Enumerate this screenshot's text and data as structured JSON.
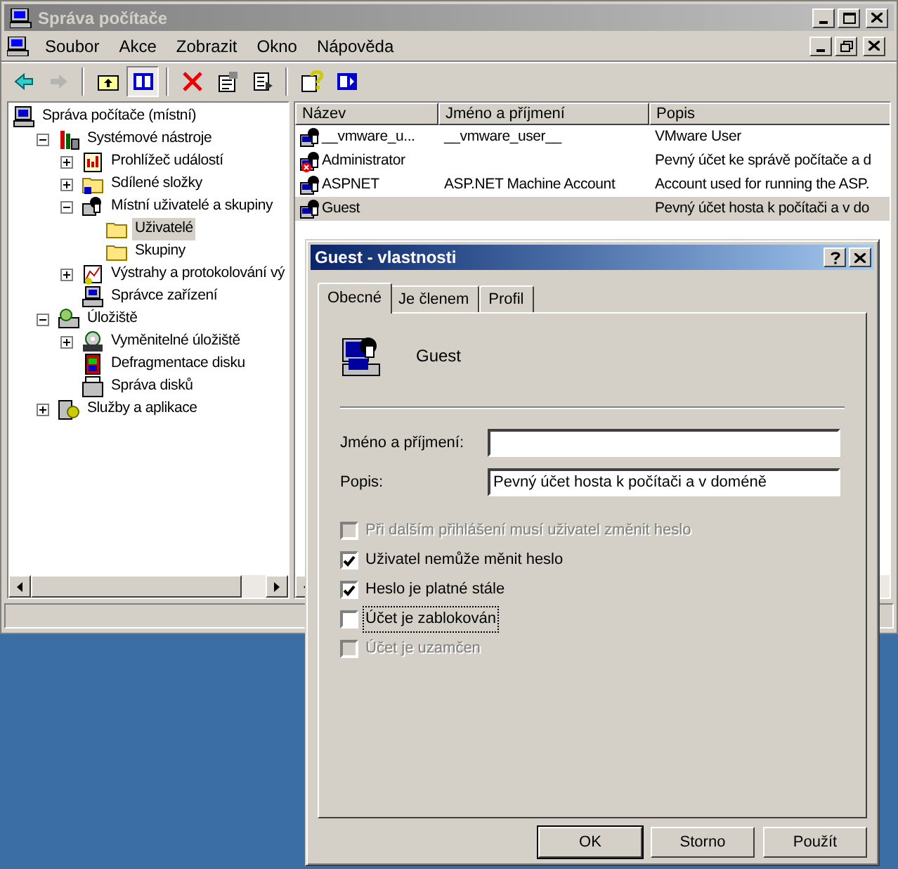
{
  "window": {
    "title": "Správa počítače"
  },
  "menu": [
    "Soubor",
    "Akce",
    "Zobrazit",
    "Okno",
    "Nápověda"
  ],
  "toolbar": [
    {
      "kind": "back",
      "disabled": false,
      "pressed": false
    },
    {
      "kind": "forward",
      "disabled": true,
      "pressed": false
    },
    {
      "kind": "separator"
    },
    {
      "kind": "up",
      "disabled": false,
      "pressed": false
    },
    {
      "kind": "tree",
      "disabled": false,
      "pressed": true
    },
    {
      "kind": "separator"
    },
    {
      "kind": "delete",
      "disabled": false,
      "pressed": false
    },
    {
      "kind": "properties",
      "disabled": false,
      "pressed": false
    },
    {
      "kind": "export",
      "disabled": false,
      "pressed": false
    },
    {
      "kind": "separator"
    },
    {
      "kind": "help",
      "disabled": false,
      "pressed": false
    },
    {
      "kind": "panel",
      "disabled": false,
      "pressed": false
    }
  ],
  "tree": [
    {
      "label": "Správa počítače (místní)",
      "selected": false,
      "children": [
        {
          "label": "Systémové nástroje",
          "selected": false,
          "expanded": true,
          "children": [
            {
              "label": "Prohlížeč událostí",
              "selected": false,
              "expanded": false
            },
            {
              "label": "Sdílené složky",
              "selected": false,
              "expanded": false
            },
            {
              "label": "Místní uživatelé a skupiny",
              "selected": false,
              "expanded": true,
              "children": [
                {
                  "label": "Uživatelé",
                  "selected": true
                },
                {
                  "label": "Skupiny",
                  "selected": false
                }
              ]
            },
            {
              "label": "Výstrahy a protokolování vý",
              "selected": false,
              "expanded": false
            },
            {
              "label": "Správce zařízení",
              "selected": false
            }
          ]
        },
        {
          "label": "Úložiště",
          "selected": false,
          "expanded": true,
          "children": [
            {
              "label": "Vyměnitelné úložiště",
              "selected": false,
              "expanded": false
            },
            {
              "label": "Defragmentace disku",
              "selected": false
            },
            {
              "label": "Správa disků",
              "selected": false
            }
          ]
        },
        {
          "label": "Služby a aplikace",
          "selected": false,
          "expanded": false
        }
      ]
    }
  ],
  "table": {
    "columns": [
      "Název",
      "Jméno a příjmení",
      "Popis"
    ],
    "rows": [
      {
        "cells": [
          "__vmware_u...",
          "__vmware_user__",
          "VMware User"
        ],
        "selected": false,
        "disabled": false
      },
      {
        "cells": [
          "Administrator",
          "",
          "Pevný účet ke správě počítače a d"
        ],
        "selected": false,
        "disabled": true
      },
      {
        "cells": [
          "ASPNET",
          "ASP.NET Machine Account",
          "Account used for running the ASP."
        ],
        "selected": false,
        "disabled": false
      },
      {
        "cells": [
          "Guest",
          "",
          "Pevný účet hosta k počítači a v do"
        ],
        "selected": true,
        "disabled": false
      }
    ]
  },
  "dialog": {
    "title": "Guest - vlastnosti",
    "tabs": [
      {
        "label": "Obecné",
        "selected": true
      },
      {
        "label": "Je členem",
        "selected": false
      },
      {
        "label": "Profil",
        "selected": false
      }
    ],
    "user_name": "Guest",
    "fields": [
      {
        "label": "Jméno a příjmení:"
      },
      {
        "label": "Popis:",
        "value": "Pevný účet hosta k počítači a v doméně"
      }
    ],
    "checkboxes": [
      {
        "label": "Při dalším přihlášení musí uživatel změnit heslo",
        "checked": false,
        "disabled": true,
        "focused": false
      },
      {
        "label": "Uživatel nemůže měnit heslo",
        "checked": true,
        "disabled": false,
        "focused": false
      },
      {
        "label": "Heslo je platné stále",
        "checked": true,
        "disabled": false,
        "focused": false
      },
      {
        "label": "Účet je zablokován",
        "checked": false,
        "disabled": false,
        "focused": true
      },
      {
        "label": "Účet je uzamčen",
        "checked": false,
        "disabled": true,
        "focused": false
      }
    ],
    "buttons": [
      {
        "label": "OK",
        "default": true
      },
      {
        "label": "Storno",
        "default": false
      },
      {
        "label": "Použít",
        "default": false
      }
    ]
  }
}
